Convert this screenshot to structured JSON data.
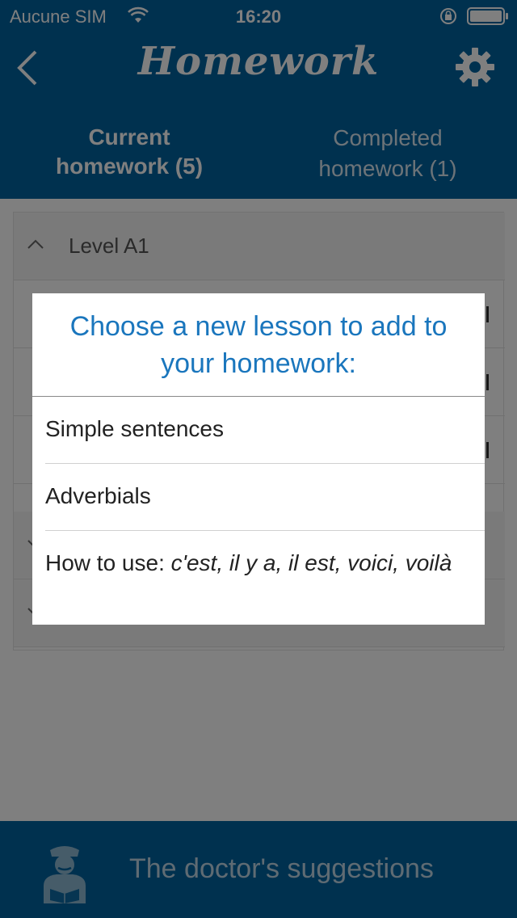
{
  "status_bar": {
    "carrier": "Aucune SIM",
    "time": "16:20"
  },
  "nav": {
    "title": "Homework",
    "icons": {
      "back": "chevron-left-icon",
      "settings": "gear-icon"
    }
  },
  "tabs": [
    {
      "line1": "Current",
      "line2": "homework (5)"
    },
    {
      "line1": "Completed",
      "line2": "homework (1)"
    }
  ],
  "list": {
    "level_label": "Level A1"
  },
  "modal": {
    "title": "Choose a new lesson to add to your homework:",
    "options": [
      {
        "label": "Simple sentences"
      },
      {
        "label": "Adverbials"
      },
      {
        "prefix": "How to use: ",
        "italic": "c'est, il y a, il est, voici, voilà"
      }
    ]
  },
  "bottom_bar": {
    "label": "The doctor's suggestions",
    "icon": "doctor-icon"
  },
  "colors": {
    "brand": "#00629e",
    "accent": "#1a76bd"
  }
}
